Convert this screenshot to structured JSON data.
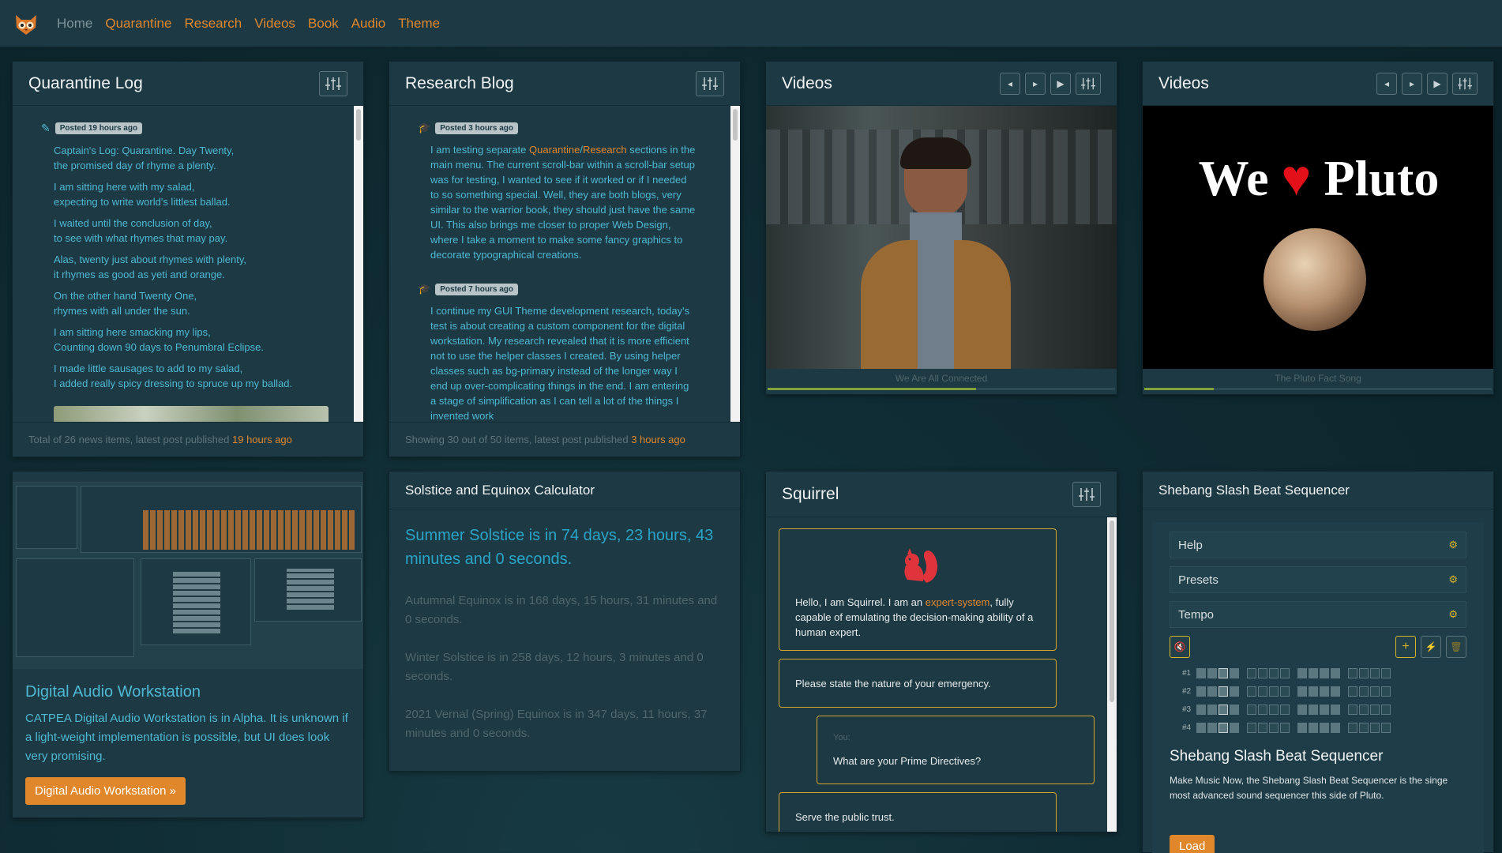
{
  "nav": {
    "items": [
      {
        "label": "Home"
      },
      {
        "label": "Quarantine"
      },
      {
        "label": "Research"
      },
      {
        "label": "Videos"
      },
      {
        "label": "Book"
      },
      {
        "label": "Audio"
      },
      {
        "label": "Theme"
      }
    ]
  },
  "quarantine": {
    "title": "Quarantine Log",
    "post_badge": "Posted 19 hours ago",
    "stanzas": [
      [
        "Captain's Log: Quarantine. Day Twenty,",
        "the promised day of rhyme a plenty."
      ],
      [
        "I am sitting here with my salad,",
        "expecting to write world's littlest ballad."
      ],
      [
        "I waited until the conclusion of day,",
        "to see with what rhymes that may pay."
      ],
      [
        "Alas, twenty just about rhymes with plenty,",
        "it rhymes as good as yeti and orange."
      ],
      [
        "On the other hand Twenty One,",
        "rhymes with all under the sun."
      ],
      [
        "I am sitting here smacking my lips,",
        "Counting down 90 days to Penumbral Eclipse."
      ],
      [
        "I made little sausages to add to my salad,",
        "I added really spicy dressing to spruce up my ballad."
      ]
    ],
    "footer_text": "Total of 26 news items, latest post published ",
    "footer_link": "19 hours ago"
  },
  "research": {
    "title": "Research Blog",
    "post1_badge": "Posted 3 hours ago",
    "post1_pre": "I am testing separate ",
    "post1_link1": "Quarantine",
    "post1_sep": "/",
    "post1_link2": "Research",
    "post1_post": " sections in the main menu. The current scroll-bar within a scroll-bar setup was for testing, I wanted to see if it worked or if I needed to so something special. Well, they are both blogs, very similar to the warrior book, they should just have the same UI. This also brings me closer to proper Web Design, where I take a moment to make some fancy graphics to decorate typographical creations.",
    "post2_badge": "Posted 7 hours ago",
    "post2_text": "I continue my GUI Theme development research, today's test is about creating a custom component for the digital workstation. My research revealed that it is more efficient not to use the helper classes I created. By using helper classes such as bg-primary instead of the longer way I end up over-complicating things in the end. I am entering a stage of simplification as I can tell a lot of the things I invented work",
    "footer_text": "Showing 30 out of 50 items, latest post published ",
    "footer_link": "3 hours ago"
  },
  "videos1": {
    "title": "Videos",
    "caption": "We Are All Connected",
    "progress": 0.6
  },
  "videos2": {
    "title": "Videos",
    "caption": "The Pluto Fact Song",
    "progress": 0.2,
    "poster_left": "We",
    "poster_right": "Pluto"
  },
  "daw": {
    "title": "Digital Audio Workstation",
    "text": "CATPEA Digital Audio Workstation is in Alpha. It is unknown if a light-weight implementation is possible, but UI does look very promising.",
    "button": "Digital Audio Workstation »"
  },
  "solstice": {
    "title": "Solstice and Equinox Calculator",
    "main": "Summer Solstice is in 74 days, 23 hours, 43 minutes and 0 seconds.",
    "items": [
      "Autumnal Equinox is in 168 days, 15 hours, 31 minutes and 0 seconds.",
      "Winter Solstice is in 258 days, 12 hours, 3 minutes and 0 seconds.",
      "2021 Vernal (Spring) Equinox is in 347 days, 11 hours, 37 minutes and 0 seconds."
    ]
  },
  "squirrel": {
    "title": "Squirrel",
    "msg1_pre": "Hello, I am Squirrel. I am an ",
    "msg1_link": "expert-system",
    "msg1_post": ", fully capable of emulating the decision-making ability of a human expert.",
    "msg2": "Please state the nature of your emergency.",
    "you_label": "You:",
    "you_msg": "What are your Prime Directives?",
    "msg3": "Serve the public trust."
  },
  "sequencer": {
    "title": "Shebang Slash Beat Sequencer",
    "accordions": [
      {
        "label": "Help"
      },
      {
        "label": "Presets"
      },
      {
        "label": "Tempo"
      }
    ],
    "rows": [
      {
        "label": "#1"
      },
      {
        "label": "#2"
      },
      {
        "label": "#3"
      },
      {
        "label": "#4"
      }
    ],
    "heading": "Shebang Slash Beat Sequencer",
    "text": "Make Music Now, the Shebang Slash Beat Sequencer is the singe most advanced sound sequencer this side of Pluto.",
    "load": "Load"
  }
}
